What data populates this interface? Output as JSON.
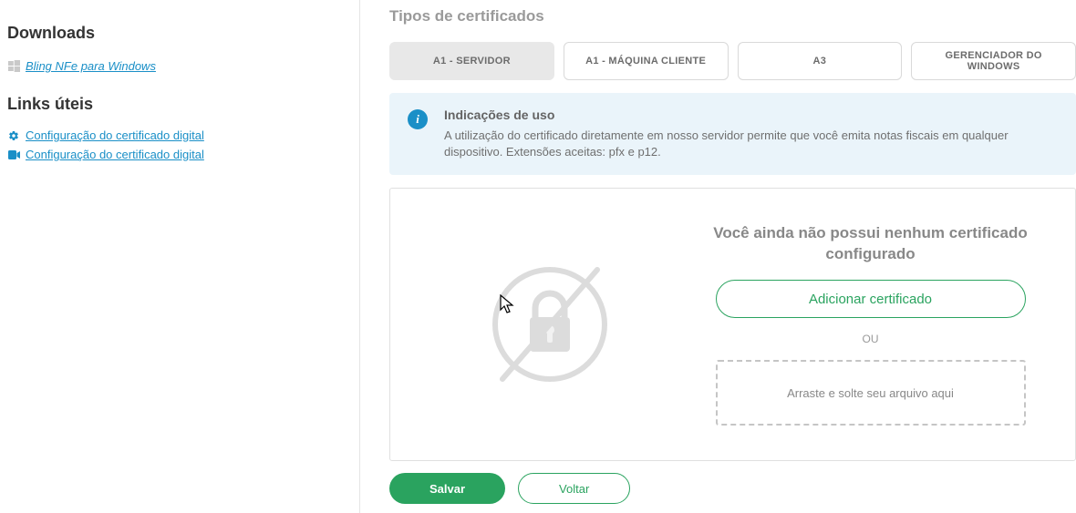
{
  "sidebar": {
    "heading_downloads": "Downloads",
    "download_link": "Bling NFe para Windows",
    "heading_links": "Links úteis",
    "link1": "Configuração do certificado digital",
    "link2": "Configuração do certificado digital"
  },
  "main": {
    "section_title": "Tipos de certificados",
    "tabs": [
      {
        "label": "A1 - SERVIDOR"
      },
      {
        "label": "A1 - MÁQUINA CLIENTE"
      },
      {
        "label": "A3"
      },
      {
        "label": "GERENCIADOR DO WINDOWS"
      }
    ],
    "info": {
      "title": "Indicações de uso",
      "body": "A utilização do certificado diretamente em nosso servidor permite que você emita notas fiscais em qualquer dispositivo. Extensões aceitas: pfx e p12."
    },
    "empty": {
      "title": "Você ainda não possui nenhum certificado configurado",
      "add_button": "Adicionar certificado",
      "or": "OU",
      "drop_hint": "Arraste e solte seu arquivo aqui"
    },
    "footer": {
      "save": "Salvar",
      "back": "Voltar"
    }
  }
}
